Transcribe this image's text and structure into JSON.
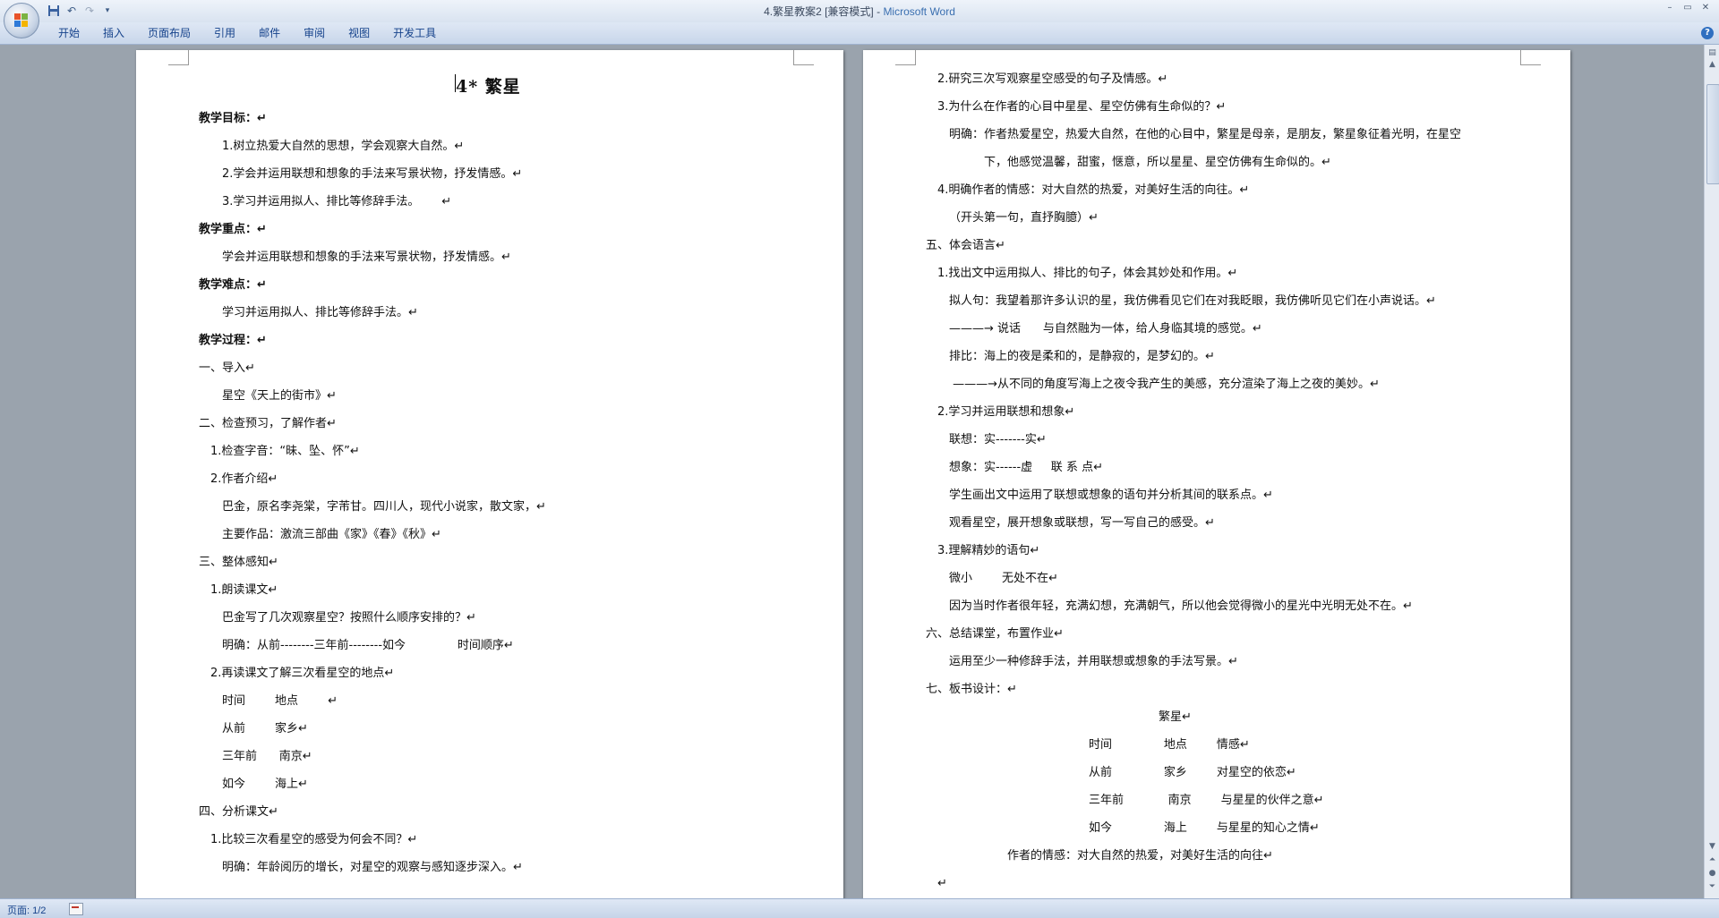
{
  "window": {
    "title": "4.繁星教案2 [兼容模式] - ",
    "app_name": "Microsoft Word",
    "controls": [
      "–",
      "▭",
      "✕"
    ]
  },
  "quick_access": {
    "icons": [
      "save-icon",
      "undo-icon",
      "redo-icon",
      "customize-dropdown-icon"
    ]
  },
  "ribbon": {
    "tabs": [
      "开始",
      "插入",
      "页面布局",
      "引用",
      "邮件",
      "审阅",
      "视图",
      "开发工具"
    ],
    "help": "?"
  },
  "page1": {
    "title": "4* 繁星",
    "lines": [
      {
        "text": "教学目标：↵",
        "bold": true,
        "indent": 0
      },
      {
        "text": "1.树立热爱大自然的思想，学会观察大自然。↵",
        "indent": 2
      },
      {
        "text": "2.学会并运用联想和想象的手法来写景状物，抒发情感。↵",
        "indent": 2
      },
      {
        "text": "3.学习并运用拟人、排比等修辞手法。      ↵",
        "indent": 2
      },
      {
        "text": "教学重点：↵",
        "bold": true,
        "indent": 0
      },
      {
        "text": "学会并运用联想和想象的手法来写景状物，抒发情感。↵",
        "indent": 2
      },
      {
        "text": "教学难点：↵",
        "bold": true,
        "indent": 0
      },
      {
        "text": "学习并运用拟人、排比等修辞手法。↵",
        "indent": 2
      },
      {
        "text": "教学过程：↵",
        "bold": true,
        "indent": 0
      },
      {
        "text": "一、导入↵",
        "indent": 0
      },
      {
        "text": "星空《天上的街市》↵",
        "indent": 2
      },
      {
        "text": "二、检查预习，了解作者↵",
        "indent": 0
      },
      {
        "text": "1.检查字音：“昧、坠、怀”↵",
        "indent": 1
      },
      {
        "text": "2.作者介绍↵",
        "indent": 1
      },
      {
        "text": "巴金，原名李尧棠，字芾甘。四川人，现代小说家，散文家，↵",
        "indent": 2
      },
      {
        "text": "主要作品：激流三部曲《家》《春》《秋》↵",
        "indent": 2
      },
      {
        "text": "三、整体感知↵",
        "indent": 0
      },
      {
        "text": "1.朗读课文↵",
        "indent": 1
      },
      {
        "text": "巴金写了几次观察星空？按照什么顺序安排的？↵",
        "indent": 2
      },
      {
        "text": "明确：从前--------三年前--------如今              时间顺序↵",
        "indent": 2
      },
      {
        "text": "2.再读课文了解三次看星空的地点↵",
        "indent": 1
      },
      {
        "text": "时间        地点        ↵",
        "indent": 2
      },
      {
        "text": "从前        家乡↵",
        "indent": 2
      },
      {
        "text": "三年前      南京↵",
        "indent": 2
      },
      {
        "text": "如今        海上↵",
        "indent": 2
      },
      {
        "text": "四、分析课文↵",
        "indent": 0
      },
      {
        "text": "1.比较三次看星空的感受为何会不同？↵",
        "indent": 1
      },
      {
        "text": "明确：年龄阅历的增长，对星空的观察与感知逐步深入。↵",
        "indent": 2
      }
    ]
  },
  "page2": {
    "lines": [
      {
        "text": "2.研究三次写观察星空感受的句子及情感。↵",
        "indent": 1
      },
      {
        "text": "3.为什么在作者的心目中星星、星空仿佛有生命似的？↵",
        "indent": 1
      },
      {
        "text": "明确：作者热爱星空，热爱大自然，在他的心目中，繁星是母亲，是朋友，繁星象征着光明，在星空",
        "indent": 2
      },
      {
        "text": "下，他感觉温馨，甜蜜，惬意，所以星星、星空仿佛有生命似的。↵",
        "indent": 5
      },
      {
        "text": "4.明确作者的情感：对大自然的热爱，对美好生活的向往。↵",
        "indent": 1
      },
      {
        "text": "（开头第一句，直抒胸臆）↵",
        "indent": 2
      },
      {
        "text": "五、体会语言↵",
        "indent": 0
      },
      {
        "text": "1.找出文中运用拟人、排比的句子，体会其妙处和作用。↵",
        "indent": 1
      },
      {
        "text": "拟人句：我望着那许多认识的星，我仿佛看见它们在对我眨眼，我仿佛听见它们在小声说话。↵",
        "indent": 2
      },
      {
        "text": "———→ 说话      与自然融为一体，给人身临其境的感觉。↵",
        "indent": 2
      },
      {
        "text": "排比：海上的夜是柔和的，是静寂的，是梦幻的。↵",
        "indent": 2
      },
      {
        "text": " ———→从不同的角度写海上之夜令我产生的美感，充分渲染了海上之夜的美妙。↵",
        "indent": 2
      },
      {
        "text": "2.学习并运用联想和想象↵",
        "indent": 1
      },
      {
        "text": "联想：实-------实↵",
        "indent": 2
      },
      {
        "text": "想象：实------虚     联 系 点↵",
        "indent": 2
      },
      {
        "text": "学生画出文中运用了联想或想象的语句并分析其间的联系点。↵",
        "indent": 2
      },
      {
        "text": "观看星空，展开想象或联想，写一写自己的感受。↵",
        "indent": 2
      },
      {
        "text": "3.理解精妙的语句↵",
        "indent": 1
      },
      {
        "text": "微小        无处不在↵",
        "indent": 2
      },
      {
        "text": "因为当时作者很年轻，充满幻想，充满朝气，所以他会觉得微小的星光中光明无处不在。↵",
        "indent": 2
      },
      {
        "text": "六、总结课堂，布置作业↵",
        "indent": 0
      },
      {
        "text": "运用至少一种修辞手法，并用联想或想象的手法写景。↵",
        "indent": 2
      },
      {
        "text": "七、板书设计：↵",
        "indent": 0
      },
      {
        "text": "繁星↵",
        "indent": 20
      },
      {
        "text": "时间              地点        情感↵",
        "indent": 14
      },
      {
        "text": "从前              家乡        对星空的依恋↵",
        "indent": 14
      },
      {
        "text": "三年前            南京        与星星的伙伴之意↵",
        "indent": 14
      },
      {
        "text": "如今              海上        与星星的知心之情↵",
        "indent": 14
      },
      {
        "text": "作者的情感：对大自然的热爱，对美好生活的向往↵",
        "indent": 7
      },
      {
        "text": "↵",
        "indent": 1
      }
    ]
  },
  "status": {
    "page": "页面: 1/2"
  }
}
